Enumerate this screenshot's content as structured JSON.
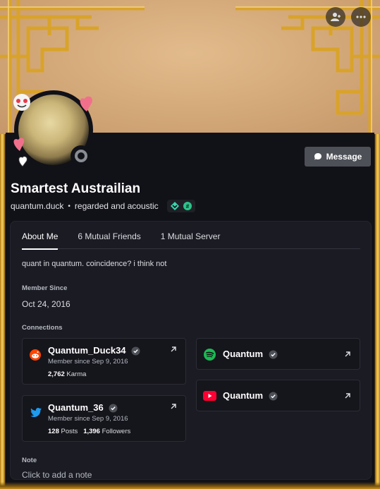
{
  "header": {
    "friend_icon": "person-add-icon",
    "more_icon": "more-icon",
    "message_label": "Message"
  },
  "profile": {
    "display_name": "Smartest Austrailian",
    "username": "quantum.duck",
    "pronouns": "regarded and acoustic",
    "status": "offline"
  },
  "tabs": [
    {
      "label": "About Me",
      "active": true
    },
    {
      "label": "6 Mutual Friends",
      "active": false
    },
    {
      "label": "1 Mutual Server",
      "active": false
    }
  ],
  "about_me": "quant in quantum. coincidence? i think not",
  "member_since": {
    "label": "Member Since",
    "value": "Oct 24, 2016"
  },
  "connections": {
    "label": "Connections",
    "items": [
      {
        "service": "reddit",
        "icon": "reddit-icon",
        "name": "Quantum_Duck34",
        "since": "Member since Sep 9, 2016",
        "stat1_value": "2,762",
        "stat1_label": "Karma"
      },
      {
        "service": "spotify",
        "icon": "spotify-icon",
        "name": "Quantum"
      },
      {
        "service": "youtube",
        "icon": "youtube-icon",
        "name": "Quantum"
      },
      {
        "service": "twitter",
        "icon": "twitter-icon",
        "name": "Quantum_36",
        "since": "Member since Sep 9, 2016",
        "stat1_value": "128",
        "stat1_label": "Posts",
        "stat2_value": "1,396",
        "stat2_label": "Followers"
      }
    ]
  },
  "note": {
    "label": "Note",
    "placeholder": "Click to add a note"
  },
  "colors": {
    "accent_gold": "#e6b23a",
    "panel": "#111118",
    "card": "#1b1b24",
    "spotify": "#1db954",
    "youtube": "#ff0033",
    "reddit": "#ff4500",
    "twitter": "#1d9bf0"
  }
}
